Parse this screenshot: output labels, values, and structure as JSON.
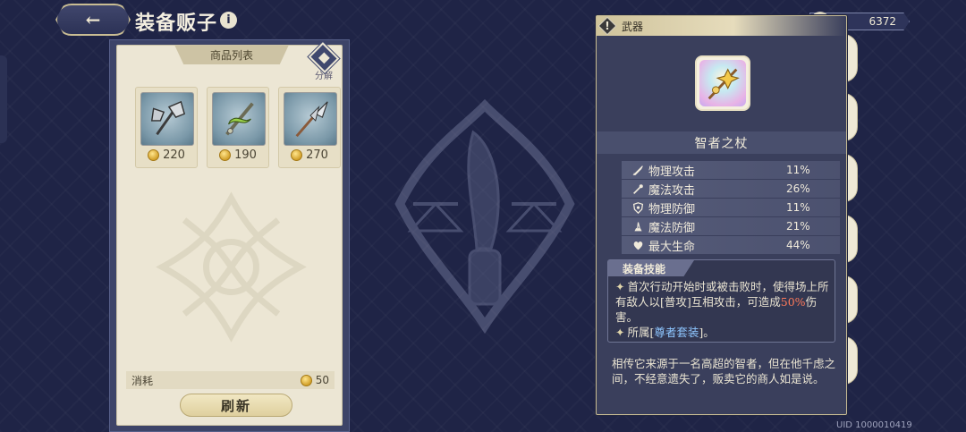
{
  "header": {
    "back_glyph": "←",
    "title": "装备贩子",
    "info_glyph": "i"
  },
  "shop": {
    "list_tab": "商品列表",
    "decompose_label": "分解",
    "goods": [
      {
        "icon": "axe-icon",
        "price": "220"
      },
      {
        "icon": "serpent-sword-icon",
        "price": "190"
      },
      {
        "icon": "spear-icon",
        "price": "270"
      }
    ],
    "cost_label": "消耗",
    "cost_value": "50",
    "refresh_label": "刷新"
  },
  "currency": {
    "amount": "6372"
  },
  "detail": {
    "category": "武器",
    "warning_glyph": "!",
    "item_name": "智者之杖",
    "stats": [
      {
        "icon": "sword-icon",
        "label": "物理攻击",
        "value": "11%"
      },
      {
        "icon": "wand-icon",
        "label": "魔法攻击",
        "value": "26%"
      },
      {
        "icon": "shield-icon",
        "label": "物理防御",
        "value": "11%"
      },
      {
        "icon": "magic-shield-icon",
        "label": "魔法防御",
        "value": "21%"
      },
      {
        "icon": "heart-icon",
        "label": "最大生命",
        "value": "44%"
      }
    ],
    "skill_title": "装备技能",
    "skill_line1_prefix": "首次行动开始时或被击败时，使得场上所有敌人以[普攻]互相攻击，可造成",
    "skill_line1_highlight": "50%",
    "skill_line1_suffix": "伤害。",
    "skill_line2_prefix": "所属[",
    "skill_line2_highlight": "尊者套装",
    "skill_line2_suffix": "]。",
    "star_glyph": "✦",
    "flavor": "相传它来源于一名高超的智者，但在他千虑之间，不经意遗失了，贩卖它的商人如是说。"
  },
  "footer": {
    "uid": "UID 1000010419"
  },
  "colors": {
    "background": "#1f2446",
    "panel_cream": "#ece6d4",
    "gold": "#c9bd93",
    "highlight_red": "#ff7a5a",
    "highlight_blue": "#8ec6ff"
  }
}
